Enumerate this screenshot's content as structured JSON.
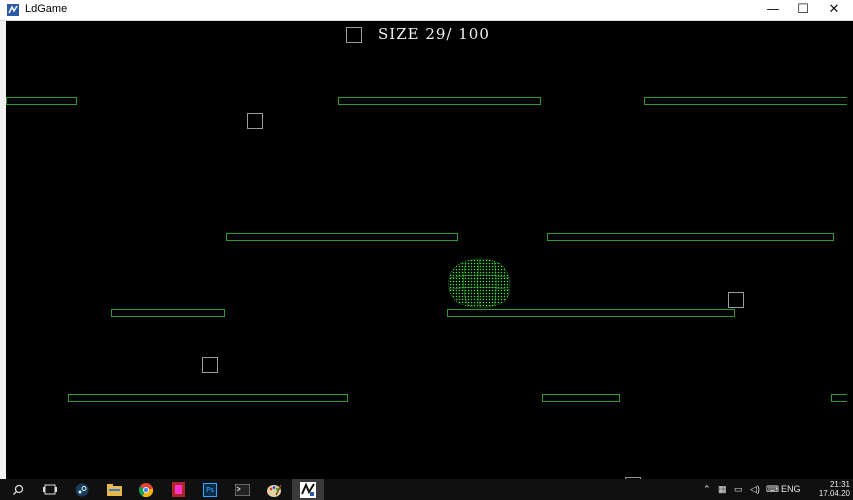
{
  "window": {
    "title": "LdGame",
    "minimize_glyph": "—",
    "maximize_glyph": "☐",
    "close_glyph": "✕"
  },
  "hud": {
    "size_text": "SIZE 29/ 100",
    "size_current": 29,
    "size_max": 100
  },
  "colors": {
    "platform": "#2f9a33",
    "player": "#3fe23f",
    "collectible": "#9a9a9a",
    "background": "#000000"
  },
  "taskbar": {
    "apps": [
      "search-icon",
      "task-view-icon",
      "steam-icon",
      "file-explorer-icon",
      "chrome-icon",
      "media-player-icon",
      "photoshop-icon",
      "terminal-icon",
      "paint-icon",
      "ldgame-icon"
    ],
    "photoshop_label": "Ps",
    "language": "ENG",
    "time": "21:31",
    "date": "17.04.20"
  }
}
